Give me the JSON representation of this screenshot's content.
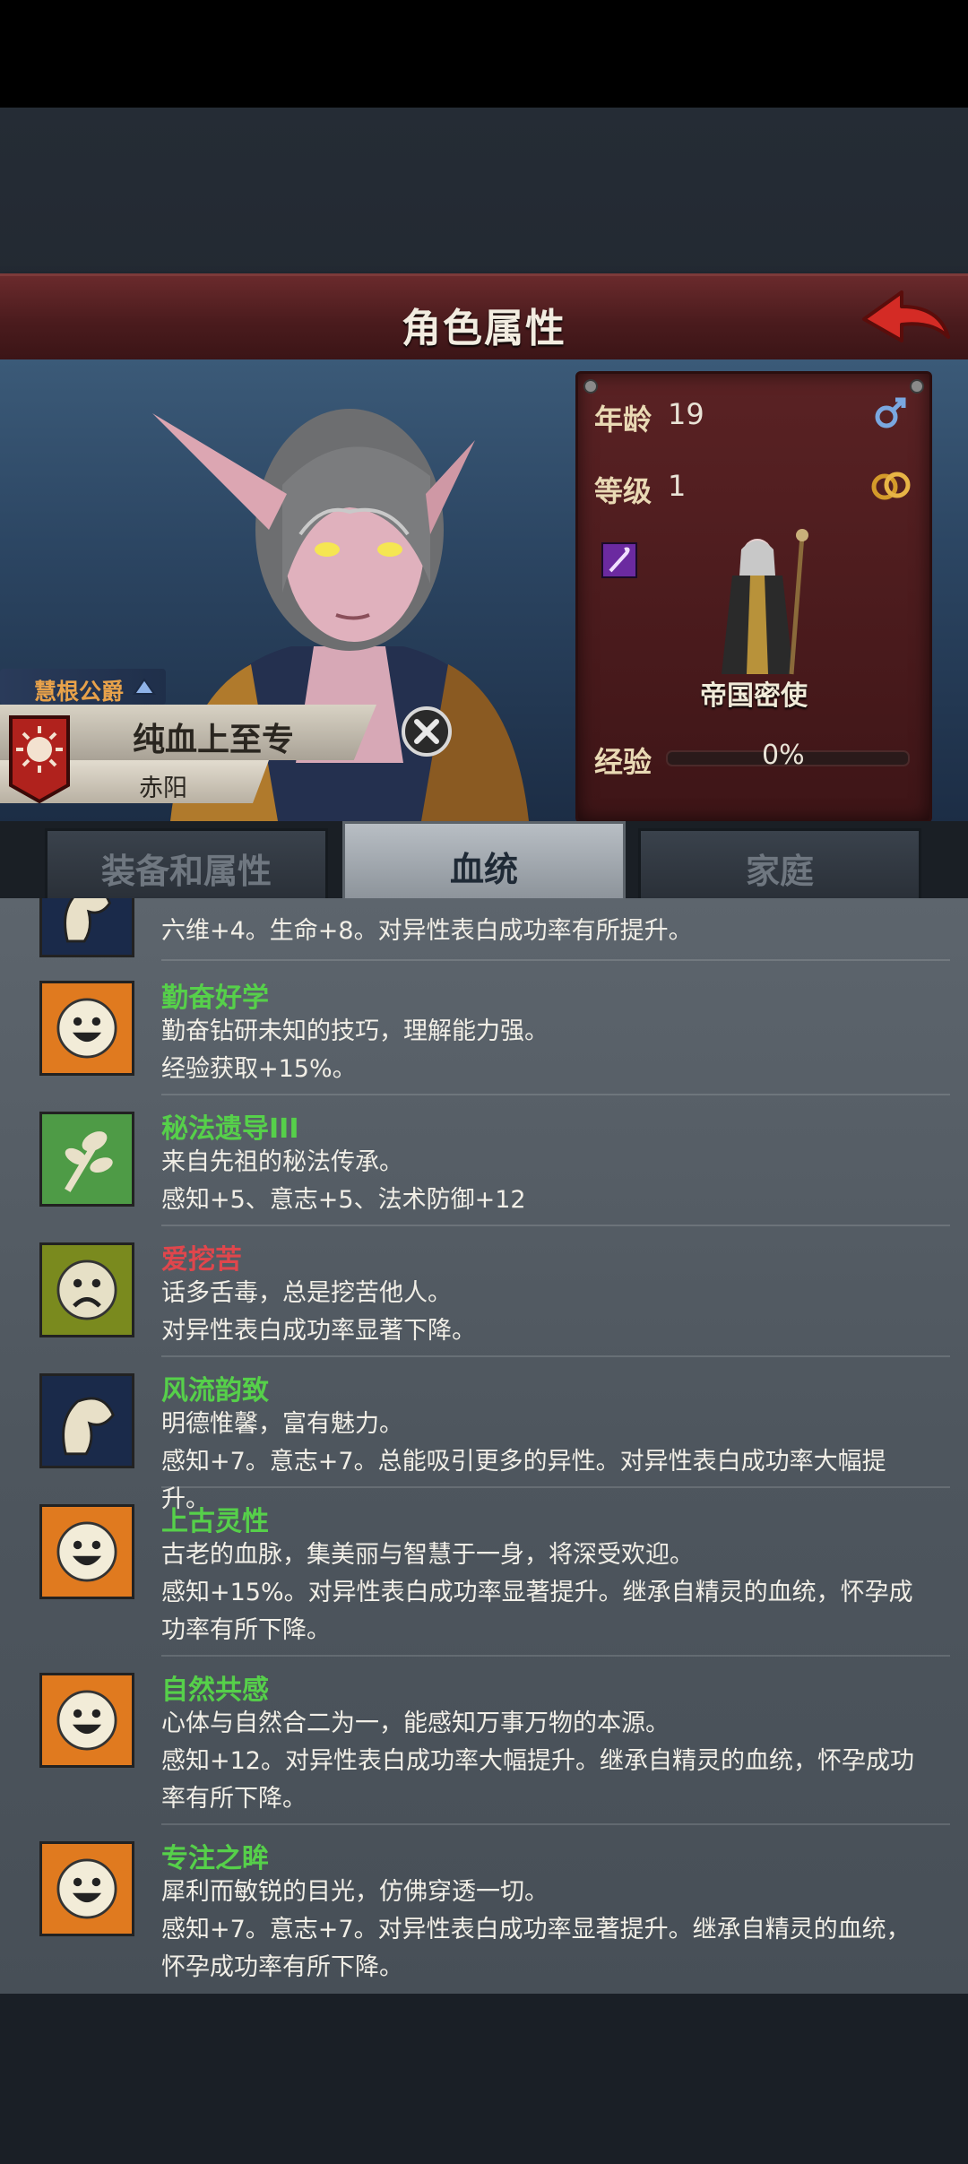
{
  "screen_title": "角色属性",
  "character": {
    "title_rank": "慧根公爵",
    "name": "纯血上至专",
    "place": "赤阳"
  },
  "stats": {
    "age_label": "年龄",
    "age_value": "19",
    "level_label": "等级",
    "level_value": "1",
    "class_name": "帝国密使",
    "exp_label": "经验",
    "exp_value": "0%",
    "exp_fraction": 0
  },
  "tabs": [
    {
      "label": "装备和属性",
      "active": false
    },
    {
      "label": "血统",
      "active": true
    },
    {
      "label": "家庭",
      "active": false
    }
  ],
  "traits": {
    "t0": {
      "desc1": "六维+4。生命+8。对异性表白成功率有所提升。",
      "icon": "flexed-arm-icon"
    },
    "t1": {
      "name": "勤奋好学",
      "desc1": "勤奋钻研未知的技巧，理解能力强。",
      "desc2": "经验获取+15%。",
      "color": "green",
      "icon": "smiley-face-icon"
    },
    "t2": {
      "name": "秘法遗导III",
      "desc1": "来自先祖的秘法传承。",
      "desc2": "感知+5、意志+5、法术防御+12",
      "color": "green",
      "icon": "leaf-branch-icon"
    },
    "t3": {
      "name": "爱挖苦",
      "desc1": "话多舌毒，总是挖苦他人。",
      "desc2": "对异性表白成功率显著下降。",
      "color": "red",
      "icon": "frown-face-icon"
    },
    "t4": {
      "name": "风流韵致",
      "desc1": "明德惟馨，富有魅力。",
      "desc2": "感知+7。意志+7。总能吸引更多的异性。对异性表白成功率大幅提升。",
      "color": "green",
      "icon": "flexed-arm-icon"
    },
    "t5": {
      "name": "上古灵性",
      "desc1": "古老的血脉，集美丽与智慧于一身，将深受欢迎。",
      "desc2": "感知+15%。对异性表白成功率显著提升。继承自精灵的血统，怀孕成",
      "desc3": "功率有所下降。",
      "color": "green",
      "icon": "smiley-face-icon"
    },
    "t6": {
      "name": "自然共感",
      "desc1": "心体与自然合二为一，能感知万事万物的本源。",
      "desc2": "感知+12。对异性表白成功率大幅提升。继承自精灵的血统，怀孕成功",
      "desc3": "率有所下降。",
      "color": "green",
      "icon": "smiley-face-icon"
    },
    "t7": {
      "name": "专注之眸",
      "desc1": "犀利而敏锐的目光，仿佛穿透一切。",
      "desc2": "感知+7。意志+7。对异性表白成功率显著提升。继承自精灵的血统，",
      "desc3": "怀孕成功率有所下降。",
      "color": "green",
      "icon": "smiley-face-icon"
    }
  },
  "colors": {
    "accent_red": "#5a2224",
    "trait_green": "#56d04a",
    "trait_red": "#e0464c",
    "exp_fill": "#c59a48"
  }
}
